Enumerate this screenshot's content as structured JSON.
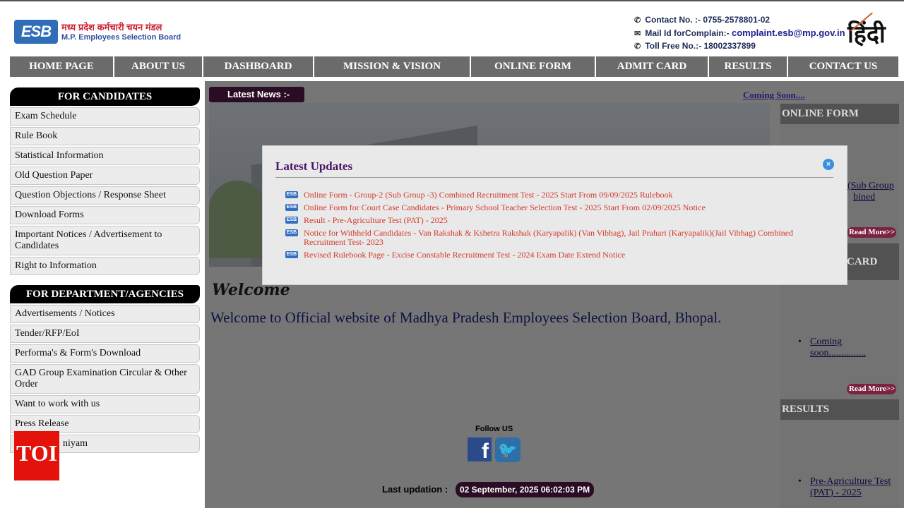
{
  "header": {
    "logo_badge": "ESB",
    "logo_hindi": "मध्य प्रदेश कर्मचारी चयन मंडल",
    "logo_english": "M.P. Employees Selection Board",
    "contact_no": "Contact No. :- 0755-2578801-02",
    "mail_label": "Mail Id forComplain:-",
    "mail_value": "complaint.esb@mp.gov.in",
    "toll_free": "Toll Free No.:- 18002337899",
    "hindi_toggle": "हिंदी"
  },
  "nav": [
    {
      "label": "HOME PAGE"
    },
    {
      "label": "ABOUT US"
    },
    {
      "label": "DASHBOARD"
    },
    {
      "label": "MISSION & VISION"
    },
    {
      "label": "ONLINE FORM"
    },
    {
      "label": "ADMIT CARD"
    },
    {
      "label": "RESULTS"
    },
    {
      "label": "CONTACT US"
    }
  ],
  "candidates": {
    "title": "FOR CANDIDATES",
    "items": [
      "Exam Schedule",
      "Rule Book",
      "Statistical Information",
      "Old Question Paper",
      "Question Objections / Response Sheet",
      "Download Forms",
      "Important Notices / Advertisement to Candidates",
      "Right to Information"
    ]
  },
  "department": {
    "title": "FOR DEPARTMENT/AGENCIES",
    "items": [
      "Advertisements / Notices",
      "Tender/RFP/EoI",
      "Performa's & Form's Download",
      "GAD Group Examination Circular & Other Order",
      "Want to work with us",
      "Press Release",
      "niyam"
    ]
  },
  "news": {
    "label": "Latest News :-",
    "coming_soon": "Coming Soon...."
  },
  "welcome": {
    "script": "Welcome",
    "text": "Welcome to Official website of Madhya Pradesh Employees Selection Board, Bhopal."
  },
  "footer": {
    "follow": "Follow US",
    "fb_glyph": "f",
    "last_update_label": "Last updation :",
    "last_update_value": "02 September, 2025 06:02:03 PM"
  },
  "right": {
    "online_form_head": "ONLINE FORM",
    "online_form_link_1": "(Sub Group",
    "online_form_link_2": "bined",
    "read_more": "Read More>>",
    "admit_card_head": "CARD",
    "admit_coming_1": "Coming",
    "admit_coming_2": "soon...............",
    "results_head": "RESULTS",
    "results_link_1": "Pre-Agriculture Test",
    "results_link_2": "(PAT) - 2025"
  },
  "modal": {
    "title": "Latest Updates",
    "close": "×",
    "icon_label": "ESB",
    "updates": [
      "Online Form - Group-2 (Sub Group -3) Combined Recruitment Test - 2025 Start From 09/09/2025  Rulebook",
      "Online Form for Court Case Candidates - Primary School Teacher Selection Test - 2025 Start From 02/09/2025    Notice",
      "Result - Pre-Agriculture Test (PAT) - 2025",
      "Notice for Withheld Candidates - Van Rakshak & Kshetra Rakshak (Karyapalik) (Van Vibhag), Jail Prahari (Karyapalik)(Jail Vibhag) Combined Recruitment Test- 2023",
      "Revised Rulebook Page - Excise Constable Recruitment Test - 2024  Exam Date Extend Notice"
    ]
  },
  "watermark": "TOI"
}
